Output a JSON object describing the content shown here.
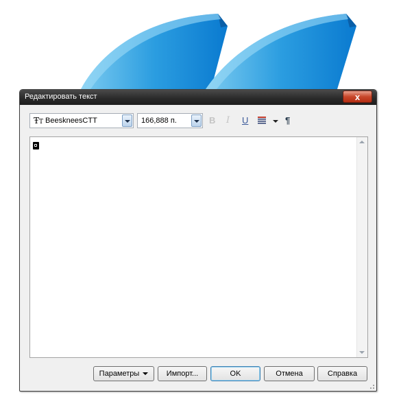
{
  "background": {
    "shape_color_light": "#5fb8ea",
    "shape_color_dark": "#0a7ad0"
  },
  "dialog": {
    "title": "Редактировать текст",
    "close_symbol": "x"
  },
  "toolbar": {
    "font_name": "BeesknеesCTT",
    "font_size": "166,888 п.",
    "font_icon": "font-type-icon",
    "bold_icon": "B",
    "italic_icon": "I",
    "underline_icon": "U",
    "align_icon": "align-list-icon",
    "paragraph_icon": "¶"
  },
  "editor": {
    "content": ""
  },
  "buttons": {
    "params": "Параметры",
    "import": "Импорт...",
    "ok": "OK",
    "cancel": "Отмена",
    "help": "Справка"
  }
}
